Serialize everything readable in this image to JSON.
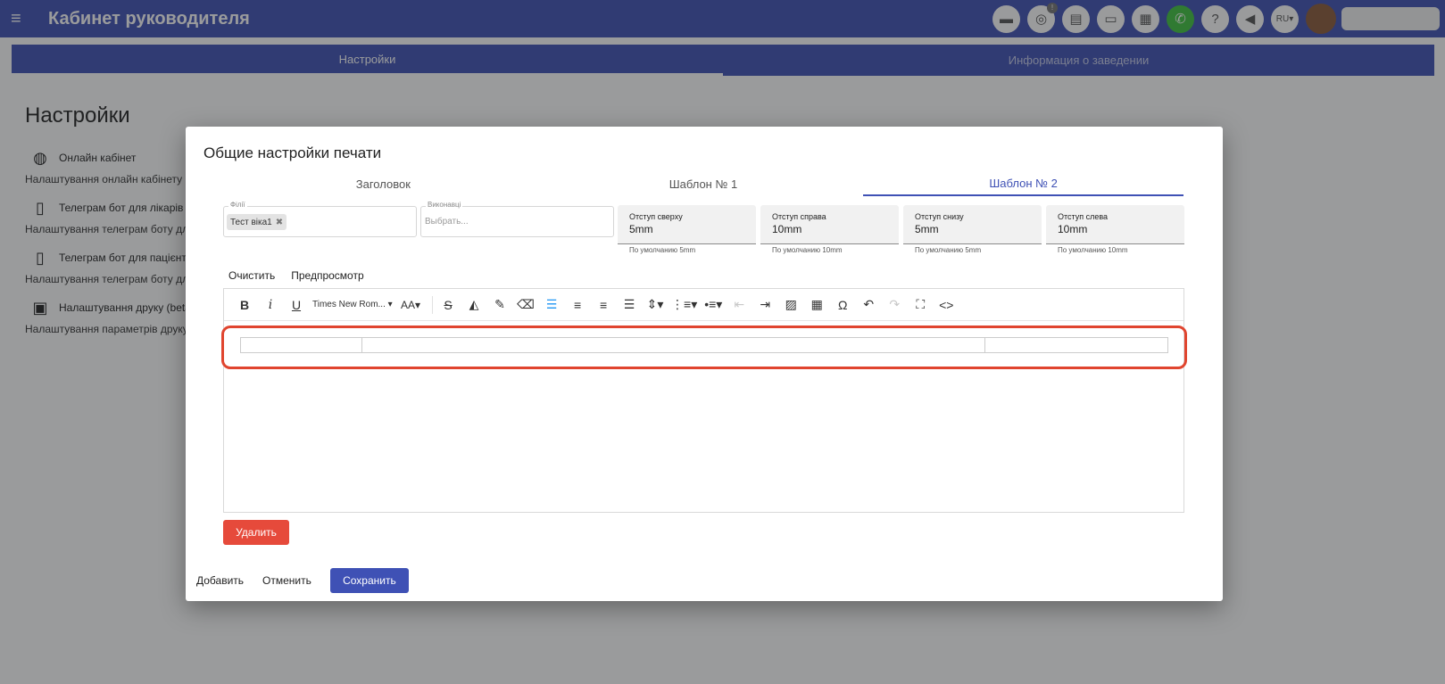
{
  "app": {
    "title": "Кабинет руководителя",
    "menu_icon": "menu-icon",
    "language": "RU",
    "top_icons": [
      "chat-icon",
      "fingerprint-icon",
      "pdf-icon",
      "credit-card-icon",
      "calculator-icon",
      "phone-icon",
      "help-icon",
      "megaphone-icon"
    ],
    "notification_badge": "!"
  },
  "page": {
    "tabs": [
      "Настройки",
      "Информация о заведении"
    ],
    "heading": "Настройки",
    "items": [
      {
        "title": "Онлайн кабінет",
        "desc": "Налаштування онлайн кабінету",
        "icon": "globe-icon"
      },
      {
        "title": "Телеграм бот для лікарів",
        "desc": "Налаштування телеграм боту для лікарів",
        "icon": "phone-check-icon"
      },
      {
        "title": "Телеграм бот для пацієнтів",
        "desc": "Налаштування телеграм боту для пацієнтів",
        "icon": "phone-check-icon"
      },
      {
        "title": "Налаштування друку (beta)",
        "desc": "Налаштування параметрів друку",
        "icon": "printer-icon"
      }
    ]
  },
  "modal": {
    "title": "Общие настройки печати",
    "tabs": [
      "Заголовок",
      "Шаблон № 1",
      "Шаблон № 2"
    ],
    "active_tab": 2,
    "branches": {
      "label": "Філії",
      "chip": "Тест віка1"
    },
    "executors": {
      "label": "Виконавці",
      "placeholder": "Выбрать..."
    },
    "margins": [
      {
        "label": "Отступ сверху",
        "value": "5mm",
        "hint": "По умолчанию 5mm"
      },
      {
        "label": "Отступ справа",
        "value": "10mm",
        "hint": "По умолчанию 10mm"
      },
      {
        "label": "Отступ снизу",
        "value": "5mm",
        "hint": "По умолчанию 5mm"
      },
      {
        "label": "Отступ слева",
        "value": "10mm",
        "hint": "По умолчанию 10mm"
      }
    ],
    "editor_actions": {
      "clear": "Очистить",
      "preview": "Предпросмотр"
    },
    "editor": {
      "font": "Times New Rom...",
      "toolbar": {
        "bold": "B",
        "italic": "i",
        "underline": "U",
        "font_size": "AA",
        "strike": "S",
        "omega": "Ω",
        "undo": "↶",
        "redo": "↷",
        "code": "<>"
      }
    },
    "buttons": {
      "delete": "Удалить",
      "add": "Добавить",
      "cancel": "Отменить",
      "save": "Сохранить"
    }
  },
  "colors": {
    "primary": "#3f51b5",
    "danger": "#e64a3b",
    "highlight": "#e0452f",
    "accent": "#2196f3"
  }
}
